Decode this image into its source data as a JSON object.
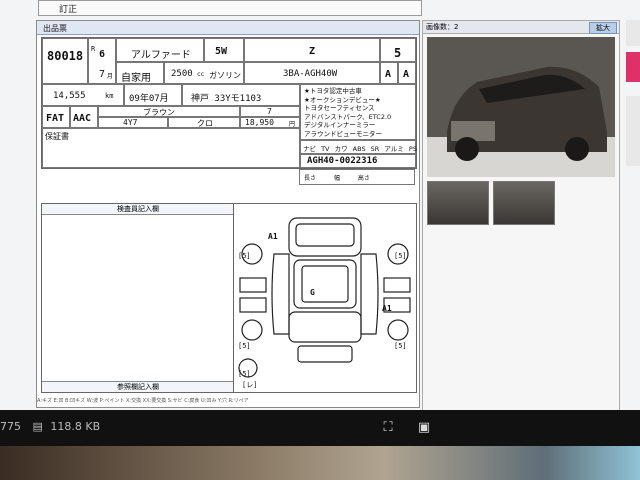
{
  "topbar": {
    "title": "訂正"
  },
  "sheet": {
    "title": "出品票",
    "lot_no": "80018",
    "year_era": "R",
    "year": "6",
    "month": "7",
    "month_unit": "月",
    "car_name": "アルファード",
    "doors": "5W",
    "grade": "Z",
    "score": "5",
    "usage": "自家用",
    "cc": "2500",
    "cc_unit": "cc",
    "fuel": "ガソリン",
    "model": "3BA-AGH40W",
    "exterior": "A",
    "interior": "A",
    "mileage": "14,555",
    "mileage_unit": "km",
    "inspection": "09年07月",
    "plate": "神戸 33Yモ1103",
    "shift": "FAT",
    "aircon": "AAC",
    "color": "ブラウン",
    "color_code": "4Y7",
    "interior_color": "クロ",
    "seats": "7",
    "recycle": "18,950",
    "recycle_unit": "円",
    "sales_points": [
      "★トヨタ認定中古車",
      "★オークションデビュー★",
      "トヨタセーフティセンス",
      "アドバンストパーク、ETC2.0",
      "デジタルインナーミラー",
      "アラウンドビューモニター"
    ],
    "equipment": [
      "ナビ",
      "TV",
      "カワ",
      "ABS",
      "SR",
      "アルミ",
      "PS",
      "PW"
    ],
    "chassis_no": "AGH40-0022316",
    "dims": [
      "長さ",
      "幅",
      "高さ"
    ],
    "hosho_label": "保証書",
    "inspector_notes_label": "検査員記入欄",
    "dealer_notes_label": "参照欄記入欄",
    "footnote": "A:キズ E:凹 B:凹キズ W:波 P:ペイント X:交換 XX:要交換 S:サビ C:腐食 U:凹み Y:穴 R:リペア"
  },
  "diagram": {
    "marks": [
      "A1",
      "G",
      "A1",
      "[5]",
      "[5]",
      "[5]",
      "[5]",
      "[5]",
      "[レ]"
    ]
  },
  "right_panel": {
    "photo_count": "画像数：2",
    "zoom_label": "拡大"
  },
  "taskbar": {
    "left_partial": "775",
    "file_size": "118.8 KB"
  },
  "colors": {
    "sheet_header": "#dfe7f3",
    "zoom_button": "#b8cde8",
    "edge_pink": "#e0306a"
  }
}
